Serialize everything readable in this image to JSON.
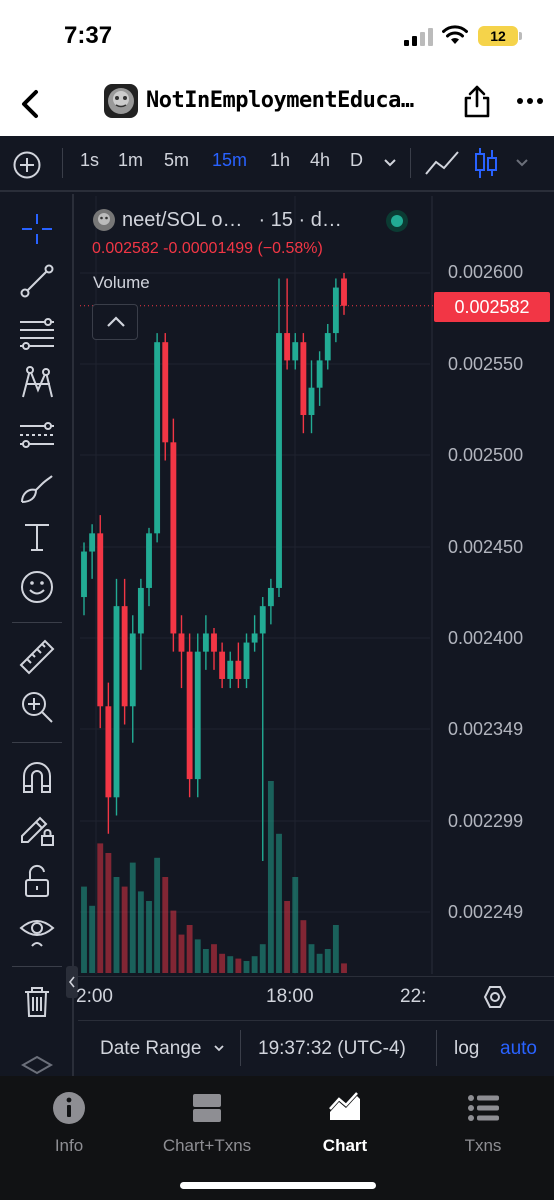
{
  "status_bar": {
    "time": "7:37",
    "battery": "12"
  },
  "nav": {
    "title": "NotInEmploymentEduca…"
  },
  "toolbar": {
    "intervals": [
      "1s",
      "1m",
      "5m",
      "15m",
      "1h",
      "4h",
      "D"
    ],
    "active_interval": "15m"
  },
  "legend": {
    "symbol": "neet/SOL o…",
    "interval": "· 15 · d…",
    "ohlc": "0.002582  -0.00001499 (−0.58%)",
    "volume_label": "Volume"
  },
  "price_axis": {
    "labels": [
      "0.002600",
      "0.002550",
      "0.002500",
      "0.002450",
      "0.002400",
      "0.002349",
      "0.002299",
      "0.002249"
    ],
    "last_price": "0.002582"
  },
  "time_axis": {
    "labels": [
      "2:00",
      "18:00",
      "22:"
    ]
  },
  "bottom_bar": {
    "date_range": "Date Range",
    "clock": "19:37:32 (UTC-4)",
    "log": "log",
    "auto": "auto"
  },
  "tabs": [
    {
      "label": "Info"
    },
    {
      "label": "Chart+Txns"
    },
    {
      "label": "Chart"
    },
    {
      "label": "Txns"
    }
  ],
  "active_tab": "Chart",
  "colors": {
    "up": "#22ab94",
    "down": "#f23645",
    "accent": "#2962ff",
    "background": "#131722"
  },
  "chart_data": {
    "type": "candlestick",
    "y_range": [
      0.00222,
      0.00263
    ],
    "candles": [
      {
        "o": 0.002422,
        "h": 0.002452,
        "l": 0.002412,
        "c": 0.002447,
        "v": 0.36
      },
      {
        "o": 0.002447,
        "h": 0.002462,
        "l": 0.002432,
        "c": 0.002457,
        "v": 0.28
      },
      {
        "o": 0.002457,
        "h": 0.002467,
        "l": 0.00235,
        "c": 0.002362,
        "v": 0.54
      },
      {
        "o": 0.002362,
        "h": 0.002375,
        "l": 0.002292,
        "c": 0.002312,
        "v": 0.5
      },
      {
        "o": 0.002312,
        "h": 0.002432,
        "l": 0.002302,
        "c": 0.002417,
        "v": 0.4
      },
      {
        "o": 0.002417,
        "h": 0.002432,
        "l": 0.002352,
        "c": 0.002362,
        "v": 0.36
      },
      {
        "o": 0.002362,
        "h": 0.002412,
        "l": 0.002342,
        "c": 0.002402,
        "v": 0.46
      },
      {
        "o": 0.002402,
        "h": 0.002432,
        "l": 0.002382,
        "c": 0.002427,
        "v": 0.34
      },
      {
        "o": 0.002427,
        "h": 0.00246,
        "l": 0.002417,
        "c": 0.002457,
        "v": 0.3
      },
      {
        "o": 0.002457,
        "h": 0.002567,
        "l": 0.002452,
        "c": 0.002562,
        "v": 0.48
      },
      {
        "o": 0.002562,
        "h": 0.002567,
        "l": 0.002497,
        "c": 0.002507,
        "v": 0.4
      },
      {
        "o": 0.002507,
        "h": 0.00252,
        "l": 0.002392,
        "c": 0.002402,
        "v": 0.26
      },
      {
        "o": 0.002402,
        "h": 0.002412,
        "l": 0.002372,
        "c": 0.002392,
        "v": 0.16
      },
      {
        "o": 0.002392,
        "h": 0.002402,
        "l": 0.002312,
        "c": 0.002322,
        "v": 0.2
      },
      {
        "o": 0.002322,
        "h": 0.002402,
        "l": 0.002312,
        "c": 0.002392,
        "v": 0.14
      },
      {
        "o": 0.002392,
        "h": 0.002412,
        "l": 0.002382,
        "c": 0.002402,
        "v": 0.1
      },
      {
        "o": 0.002402,
        "h": 0.002405,
        "l": 0.002382,
        "c": 0.002392,
        "v": 0.12
      },
      {
        "o": 0.002392,
        "h": 0.002397,
        "l": 0.002372,
        "c": 0.002377,
        "v": 0.08
      },
      {
        "o": 0.002377,
        "h": 0.002392,
        "l": 0.002372,
        "c": 0.002387,
        "v": 0.07
      },
      {
        "o": 0.002387,
        "h": 0.002397,
        "l": 0.002372,
        "c": 0.002377,
        "v": 0.06
      },
      {
        "o": 0.002377,
        "h": 0.002402,
        "l": 0.002372,
        "c": 0.002397,
        "v": 0.05
      },
      {
        "o": 0.002397,
        "h": 0.002412,
        "l": 0.002392,
        "c": 0.002402,
        "v": 0.07
      },
      {
        "o": 0.002402,
        "h": 0.002422,
        "l": 0.002277,
        "c": 0.002417,
        "v": 0.12
      },
      {
        "o": 0.002417,
        "h": 0.002432,
        "l": 0.002407,
        "c": 0.002427,
        "v": 0.8
      },
      {
        "o": 0.002427,
        "h": 0.002597,
        "l": 0.002422,
        "c": 0.002567,
        "v": 0.58
      },
      {
        "o": 0.002567,
        "h": 0.002597,
        "l": 0.002547,
        "c": 0.002552,
        "v": 0.3
      },
      {
        "o": 0.002552,
        "h": 0.002567,
        "l": 0.002547,
        "c": 0.002562,
        "v": 0.4
      },
      {
        "o": 0.002562,
        "h": 0.002567,
        "l": 0.002512,
        "c": 0.002522,
        "v": 0.22
      },
      {
        "o": 0.002522,
        "h": 0.002552,
        "l": 0.002512,
        "c": 0.002537,
        "v": 0.12
      },
      {
        "o": 0.002537,
        "h": 0.002557,
        "l": 0.002527,
        "c": 0.002552,
        "v": 0.08
      },
      {
        "o": 0.002552,
        "h": 0.002572,
        "l": 0.002547,
        "c": 0.002567,
        "v": 0.1
      },
      {
        "o": 0.002567,
        "h": 0.002597,
        "l": 0.002562,
        "c": 0.002592,
        "v": 0.2
      },
      {
        "o": 0.002597,
        "h": 0.0026,
        "l": 0.002577,
        "c": 0.002582,
        "v": 0.04
      }
    ]
  }
}
